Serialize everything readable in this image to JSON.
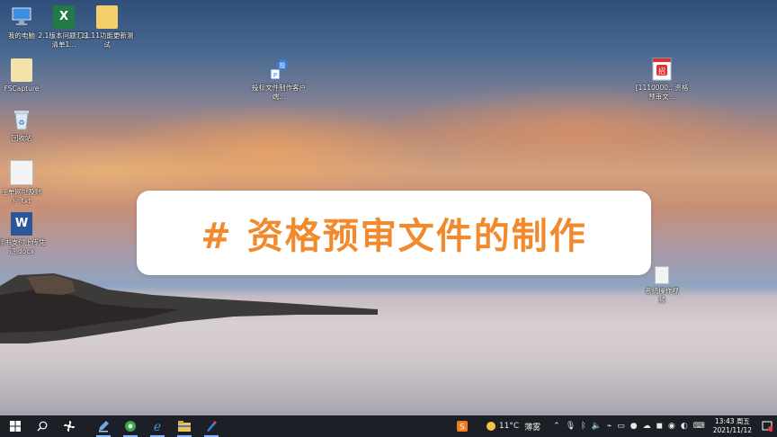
{
  "desktop": {
    "icons": [
      {
        "label": "我的电脑",
        "icon": "computer-icon"
      },
      {
        "label": "2.1版本问题汇总清单1...",
        "icon": "excel-icon"
      },
      {
        "label": "11.11功能更新测试",
        "icon": "folder-icon"
      },
      {
        "label": "FSCapture",
        "icon": "app-icon"
      },
      {
        "label": "回收站",
        "icon": "recycle-bin-icon"
      },
      {
        "label": "工单网址及账户.txt",
        "icon": "text-file-icon"
      },
      {
        "label": "标书支付上传凭证.docx",
        "icon": "word-icon"
      },
      {
        "label": "投标文件制作客户端...",
        "icon": "bid-client-icon"
      },
      {
        "label": "[1110000...资格预审文...",
        "icon": "bid-doc-icon"
      },
      {
        "label": "系统操作视频",
        "icon": "document-icon"
      }
    ]
  },
  "banner": {
    "title": "# 资格预审文件的制作",
    "color": "#f08a2c"
  },
  "taskbar": {
    "apps": [
      {
        "name": "start",
        "icon": "windows-icon"
      },
      {
        "name": "search",
        "icon": "search-icon"
      },
      {
        "name": "task-view",
        "icon": "fan-icon"
      },
      {
        "name": "app-1",
        "icon": "pen-icon"
      },
      {
        "name": "app-2",
        "icon": "browser-green-icon"
      },
      {
        "name": "edge",
        "icon": "ie-icon"
      },
      {
        "name": "explorer",
        "icon": "folder-icon"
      },
      {
        "name": "app-3",
        "icon": "paint-icon"
      }
    ],
    "pinned_right": {
      "icon": "sogou-icon"
    },
    "weather": {
      "temp": "11°C",
      "desc": "薄雾"
    },
    "clock": {
      "time": "13:43 周五",
      "date": "2021/11/12"
    }
  }
}
